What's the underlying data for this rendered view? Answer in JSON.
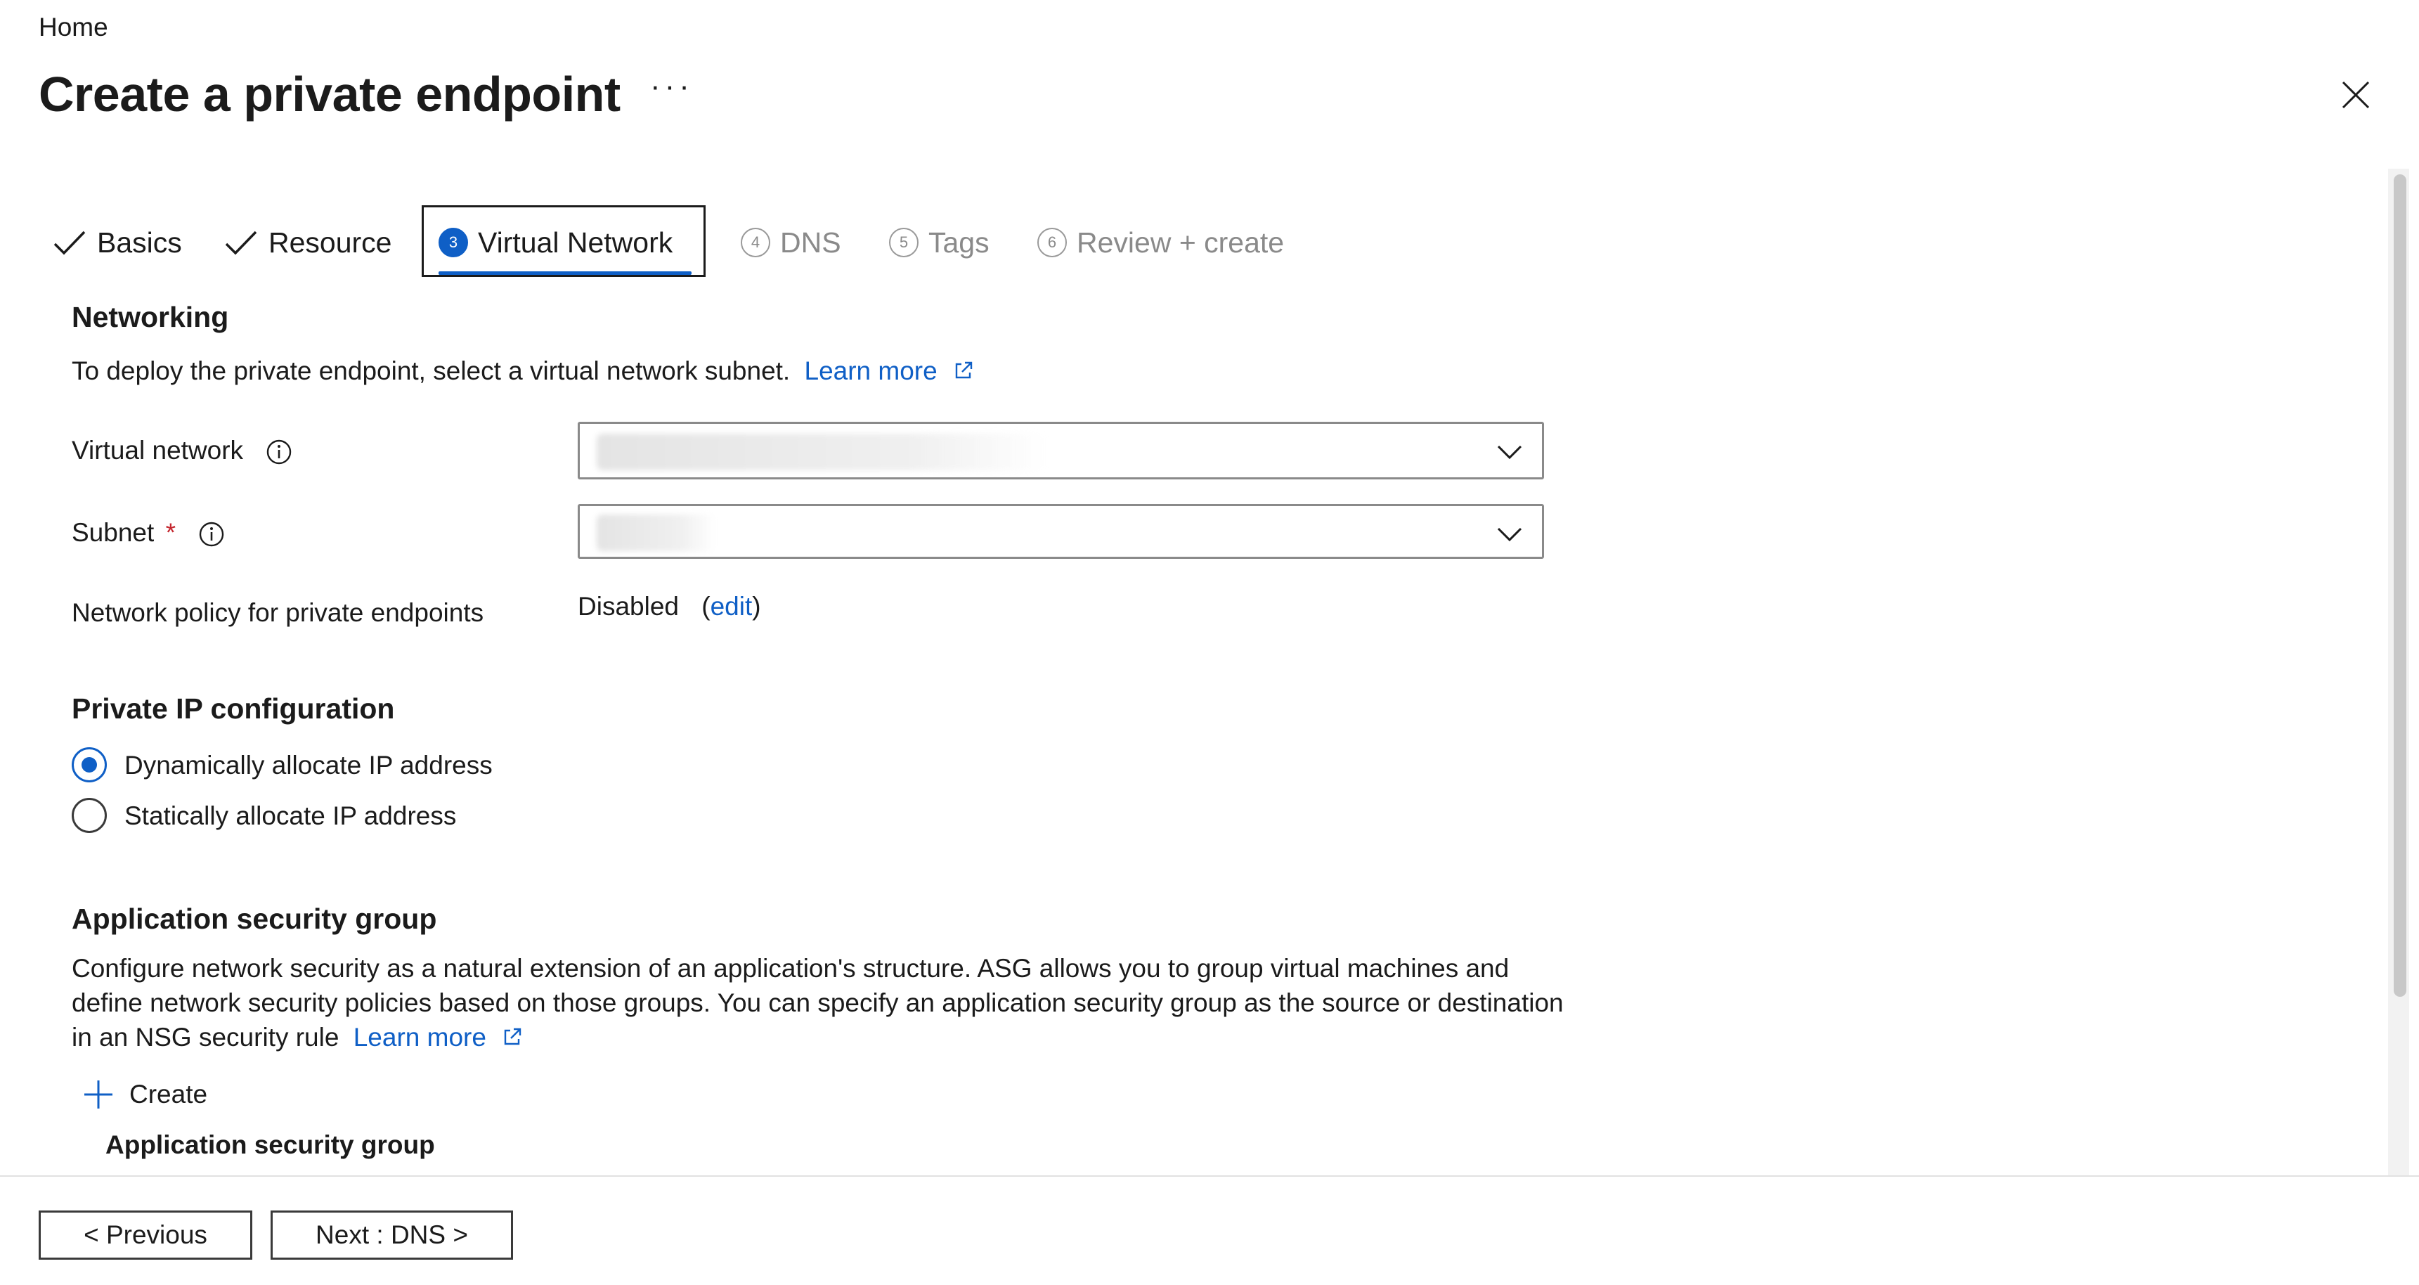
{
  "breadcrumb": "Home",
  "title": "Create a private endpoint",
  "more_label": "···",
  "tabs": [
    {
      "label": "Basics",
      "state": "done"
    },
    {
      "label": "Resource",
      "state": "done"
    },
    {
      "label": "Virtual Network",
      "number": "3",
      "state": "active"
    },
    {
      "label": "DNS",
      "number": "4",
      "state": "pending"
    },
    {
      "label": "Tags",
      "number": "5",
      "state": "pending"
    },
    {
      "label": "Review + create",
      "number": "6",
      "state": "pending"
    }
  ],
  "networking": {
    "heading": "Networking",
    "description": "To deploy the private endpoint, select a virtual network subnet.",
    "learn_more": "Learn more",
    "virtual_network_label": "Virtual network",
    "subnet_label": "Subnet",
    "required_marker": "*",
    "policy_label": "Network policy for private endpoints",
    "policy_value": "Disabled",
    "policy_edit_open": "(",
    "policy_edit": "edit",
    "policy_edit_close": ")"
  },
  "private_ip": {
    "heading": "Private IP configuration",
    "options": [
      {
        "label": "Dynamically allocate IP address",
        "selected": true
      },
      {
        "label": "Statically allocate IP address",
        "selected": false
      }
    ]
  },
  "asg": {
    "heading": "Application security group",
    "description": "Configure network security as a natural extension of an application's structure. ASG allows you to group virtual machines and define network security policies based on those groups. You can specify an application security group as the source or destination in an NSG security rule",
    "learn_more": "Learn more",
    "create_label": "Create",
    "column_header": "Application security group"
  },
  "footer": {
    "previous_label": "< Previous",
    "next_label": "Next : DNS >"
  },
  "colors": {
    "accent": "#0f5fc6",
    "required": "#c4262e",
    "muted_text": "#8a8a8a"
  }
}
